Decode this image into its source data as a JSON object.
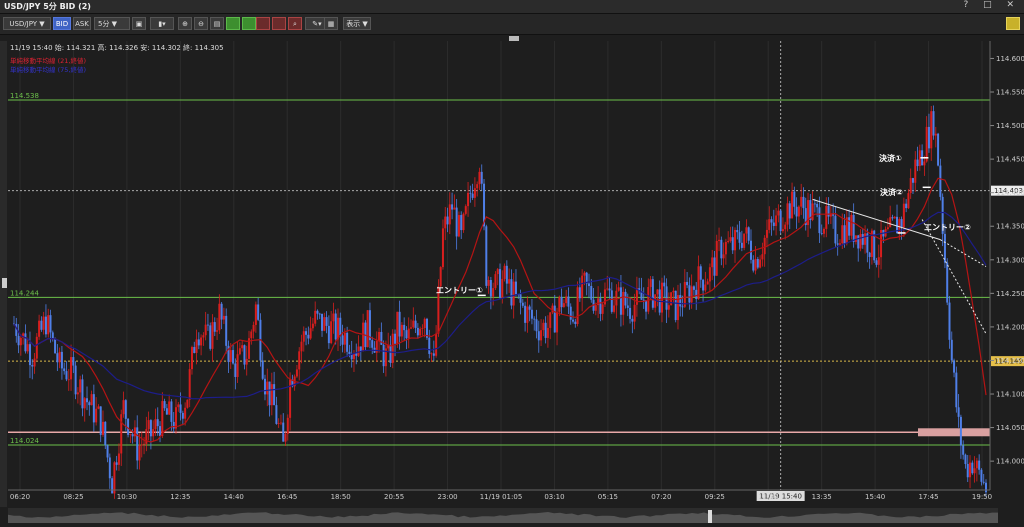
{
  "window": {
    "title": "USD/JPY 5分 BID (2)",
    "controls": "? □ ✕"
  },
  "toolbar": {
    "symbol": "USD/JPY ▼",
    "bid": "BID",
    "ask": "ASK",
    "timeframe": "5分 ▼",
    "display": "表示 ▼"
  },
  "info": {
    "ohlc": "11/19 15:40  始: 114.321  高: 114.326  安: 114.302  終: 114.305",
    "legend_red": "単純移動平均線 (21,終値)",
    "legend_blue": "単純移動平均線 (75,終値)"
  },
  "colors": {
    "up": "#d81e1e",
    "down": "#4f7fe8",
    "sma21": "#b51414",
    "sma75": "#1d1d8a",
    "level": "#6cc04a",
    "bg": "#1e1e1e"
  },
  "annotations": {
    "entry1": "エントリー①",
    "entry2": "エントリー②",
    "exit1": "決済①",
    "exit2": "決済②"
  },
  "chart_data": {
    "type": "candlestick",
    "x_ticks": [
      "06:20",
      "08:25",
      "10:30",
      "12:35",
      "14:40",
      "16:45",
      "18:50",
      "20:55",
      "23:00",
      "11/19 01:05",
      "03:10",
      "05:15",
      "07:20",
      "09:25",
      "11:30",
      "13:35",
      "15:40",
      "17:45",
      "19:50"
    ],
    "crosshair_x_label": "11/19 15:40",
    "y_ticks": [
      114.6,
      114.55,
      114.5,
      114.45,
      114.4,
      114.35,
      114.3,
      114.25,
      114.2,
      114.15,
      114.1,
      114.05,
      114.0
    ],
    "ylim": [
      113.957,
      114.626
    ],
    "crosshair_price": "114.403",
    "current_price": "114.149",
    "horizontal_levels": [
      {
        "label": "114.538",
        "value": 114.538
      },
      {
        "label": "114.244",
        "value": 114.244
      },
      {
        "label": "114.024",
        "value": 114.024
      }
    ],
    "alert_line": 114.043,
    "path": [
      [
        0,
        114.205
      ],
      [
        8,
        114.16
      ],
      [
        14,
        114.21
      ],
      [
        20,
        114.14
      ],
      [
        26,
        114.13
      ],
      [
        32,
        114.09
      ],
      [
        38,
        114.06
      ],
      [
        43,
        113.97
      ],
      [
        48,
        114.08
      ],
      [
        54,
        114.02
      ],
      [
        60,
        114.04
      ],
      [
        66,
        114.07
      ],
      [
        71,
        114.06
      ],
      [
        76,
        114.1
      ],
      [
        80,
        114.2
      ],
      [
        85,
        114.18
      ],
      [
        90,
        114.22
      ],
      [
        96,
        114.14
      ],
      [
        102,
        114.16
      ],
      [
        106,
        114.23
      ],
      [
        110,
        114.12
      ],
      [
        114,
        114.08
      ],
      [
        118,
        114.02
      ],
      [
        121,
        114.12
      ],
      [
        126,
        114.18
      ],
      [
        132,
        114.21
      ],
      [
        138,
        114.2
      ],
      [
        144,
        114.19
      ],
      [
        150,
        114.17
      ],
      [
        155,
        114.2
      ],
      [
        160,
        114.17
      ],
      [
        164,
        114.15
      ],
      [
        168,
        114.2
      ],
      [
        172,
        114.18
      ],
      [
        176,
        114.2
      ],
      [
        180,
        114.22
      ],
      [
        184,
        114.14
      ],
      [
        188,
        114.34
      ],
      [
        192,
        114.38
      ],
      [
        196,
        114.33
      ],
      [
        200,
        114.4
      ],
      [
        204,
        114.45
      ],
      [
        207,
        114.28
      ],
      [
        211,
        114.26
      ],
      [
        215,
        114.27
      ],
      [
        220,
        114.24
      ],
      [
        225,
        114.22
      ],
      [
        230,
        114.2
      ],
      [
        235,
        114.2
      ],
      [
        240,
        114.24
      ],
      [
        245,
        114.22
      ],
      [
        250,
        114.26
      ],
      [
        255,
        114.24
      ],
      [
        260,
        114.25
      ],
      [
        265,
        114.24
      ],
      [
        270,
        114.23
      ],
      [
        275,
        114.24
      ],
      [
        280,
        114.25
      ],
      [
        285,
        114.24
      ],
      [
        290,
        114.23
      ],
      [
        295,
        114.25
      ],
      [
        300,
        114.27
      ],
      [
        305,
        114.28
      ],
      [
        310,
        114.32
      ],
      [
        315,
        114.32
      ],
      [
        320,
        114.34
      ],
      [
        325,
        114.3
      ],
      [
        330,
        114.34
      ],
      [
        335,
        114.36
      ],
      [
        340,
        114.38
      ],
      [
        345,
        114.38
      ],
      [
        350,
        114.37
      ],
      [
        355,
        114.36
      ],
      [
        360,
        114.34
      ],
      [
        365,
        114.35
      ],
      [
        370,
        114.34
      ],
      [
        374,
        114.33
      ],
      [
        378,
        114.31
      ],
      [
        382,
        114.33
      ],
      [
        386,
        114.35
      ],
      [
        389,
        114.36
      ],
      [
        392,
        114.4
      ],
      [
        395,
        114.44
      ],
      [
        398,
        114.46
      ],
      [
        401,
        114.49
      ],
      [
        403,
        114.51
      ],
      [
        405,
        114.45
      ],
      [
        408,
        114.3
      ],
      [
        411,
        114.15
      ],
      [
        414,
        114.05
      ],
      [
        417,
        113.99
      ],
      [
        420,
        114.0
      ],
      [
        423,
        113.98
      ],
      [
        426,
        113.96
      ]
    ],
    "sma21_ref": [
      [
        0,
        114.21
      ],
      [
        40,
        114.12
      ],
      [
        60,
        114.07
      ],
      [
        80,
        114.13
      ],
      [
        120,
        114.15
      ],
      [
        160,
        114.19
      ],
      [
        200,
        114.29
      ],
      [
        240,
        114.24
      ],
      [
        280,
        114.24
      ],
      [
        320,
        114.3
      ],
      [
        360,
        114.36
      ],
      [
        390,
        114.33
      ],
      [
        404,
        114.37
      ],
      [
        412,
        114.34
      ],
      [
        426,
        114.0
      ]
    ],
    "sma75_ref": [
      [
        0,
        114.13
      ],
      [
        40,
        114.13
      ],
      [
        80,
        114.14
      ],
      [
        120,
        114.16
      ],
      [
        160,
        114.18
      ],
      [
        190,
        114.22
      ],
      [
        220,
        114.26
      ],
      [
        250,
        114.27
      ],
      [
        280,
        114.25
      ],
      [
        320,
        114.29
      ],
      [
        360,
        114.32
      ],
      [
        400,
        114.34
      ],
      [
        410,
        114.34
      ],
      [
        426,
        114.25
      ]
    ]
  }
}
